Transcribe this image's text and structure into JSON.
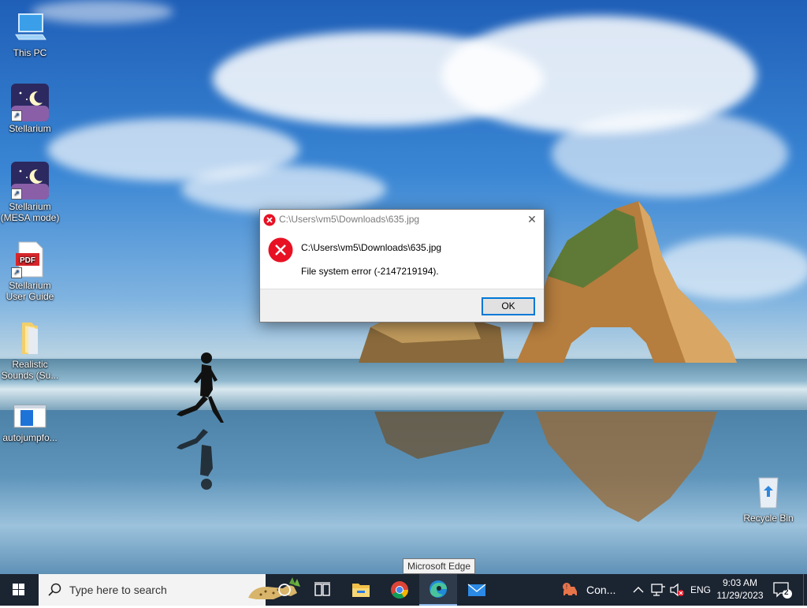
{
  "desktop": {
    "icons": [
      {
        "label": "This PC"
      },
      {
        "label": "Stellarium"
      },
      {
        "label": "Stellarium (MESA mode)"
      },
      {
        "label": "Stellarium User Guide",
        "badge": "PDF"
      },
      {
        "label": "Realistic Sounds (Su..."
      },
      {
        "label": "autojumpfo..."
      },
      {
        "label": "Recycle Bin"
      }
    ]
  },
  "dialog": {
    "title": "C:\\Users\\vm5\\Downloads\\635.jpg",
    "path": "C:\\Users\\vm5\\Downloads\\635.jpg",
    "message": "File system error (-2147219194).",
    "ok_label": "OK",
    "close_glyph": "✕"
  },
  "tooltip": {
    "text": "Microsoft Edge"
  },
  "taskbar": {
    "search_placeholder": "Type here to search",
    "tray_app_label": "Con...",
    "language": "ENG",
    "time": "9:03 AM",
    "date": "11/29/2023",
    "notification_count": "2",
    "pinned": [
      "task-view",
      "file-explorer",
      "chrome",
      "edge",
      "mail"
    ],
    "active": "edge"
  },
  "colors": {
    "taskbar_bg": "#1b2431",
    "accent": "#0078d7",
    "error_red": "#e81123"
  }
}
